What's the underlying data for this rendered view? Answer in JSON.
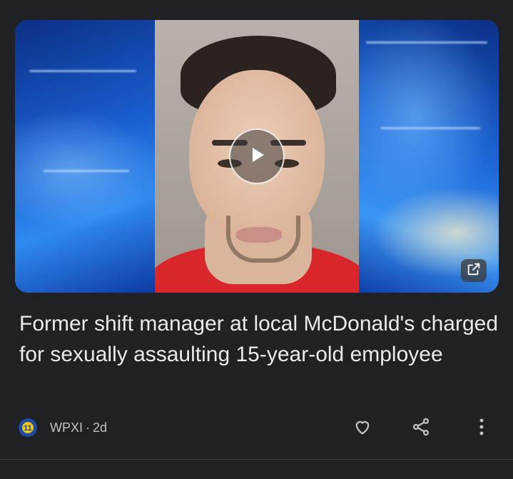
{
  "headline": "Former shift manager at local McDonald's charged for sexually assaulting 15-year-old employee",
  "source": {
    "name": "WPXI",
    "separator": "·",
    "age": "2d"
  },
  "video": {
    "has_play": true
  },
  "icons": {
    "play": "play-icon",
    "open": "open-in-new-icon",
    "like": "heart-icon",
    "share": "share-icon",
    "more": "more-vert-icon",
    "logo": "wpxi-logo-icon"
  },
  "colors": {
    "background": "#202124",
    "text": "#e8eaed",
    "secondary": "#bdc1c6",
    "logo": "#1d4ba6"
  }
}
